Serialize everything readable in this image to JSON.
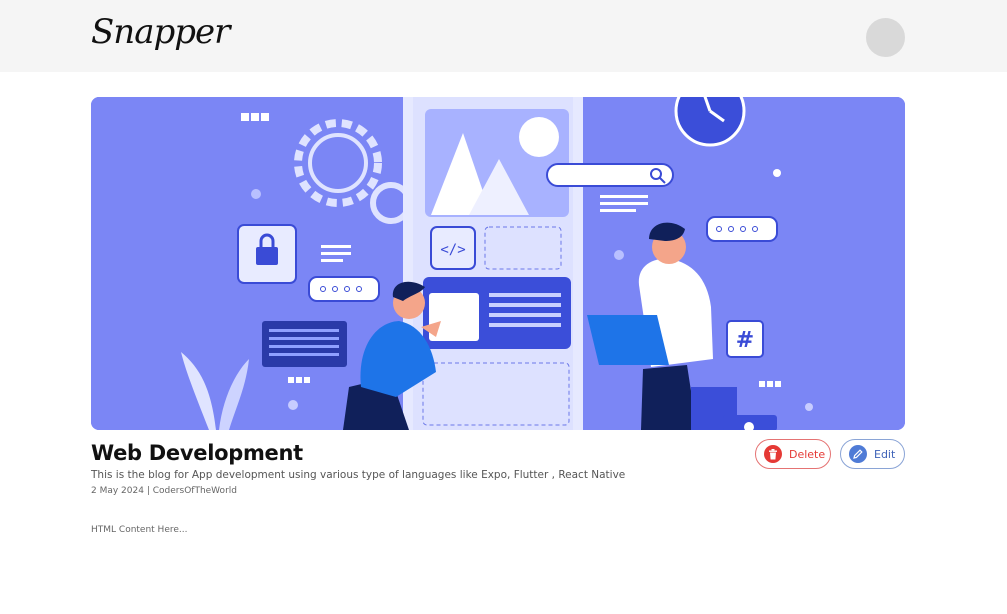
{
  "header": {
    "logo_text": "Snapper"
  },
  "post": {
    "title": "Web Development",
    "description": "This is the blog for App development using various type of languages like Expo, Flutter , React Native",
    "date": "2 May 2024",
    "separator": "|",
    "author": "CodersOfTheWorld",
    "content": "HTML Content Here..."
  },
  "actions": {
    "delete_label": "Delete",
    "edit_label": "Edit"
  },
  "icons": {
    "delete": "trash-icon",
    "edit": "pencil-icon",
    "avatar": "user-avatar"
  },
  "colors": {
    "hero_bg": "#7b86f5",
    "delete": "#e53935",
    "edit": "#4f7bd6"
  }
}
